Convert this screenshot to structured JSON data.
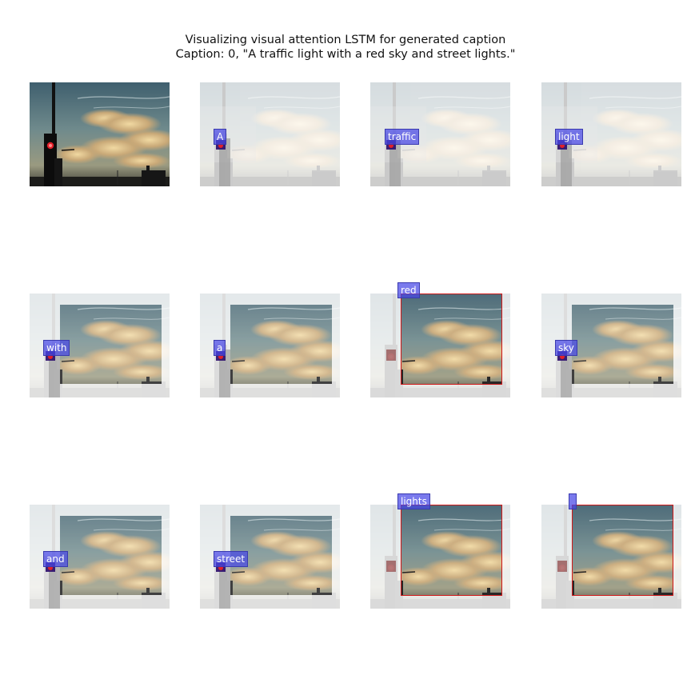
{
  "title": {
    "line1": "Visualizing visual attention LSTM for generated caption",
    "line2": "Caption: 0, \"A traffic light with a red sky and street lights.\""
  },
  "panels": [
    {
      "word": ""
    },
    {
      "word": "A"
    },
    {
      "word": "traffic"
    },
    {
      "word": "light"
    },
    {
      "word": "with"
    },
    {
      "word": "a"
    },
    {
      "word": "red"
    },
    {
      "word": "sky"
    },
    {
      "word": "and"
    },
    {
      "word": "street"
    },
    {
      "word": "lights"
    },
    {
      "word": ""
    }
  ],
  "colors": {
    "attention_box": "#d01818",
    "word_label_bg": "#4646e6",
    "traffic_light_red": "#e0202a"
  },
  "icons": {
    "original": "sunset-sky-traffic-light-photo",
    "attention": "attention-heatmap-overlay"
  }
}
